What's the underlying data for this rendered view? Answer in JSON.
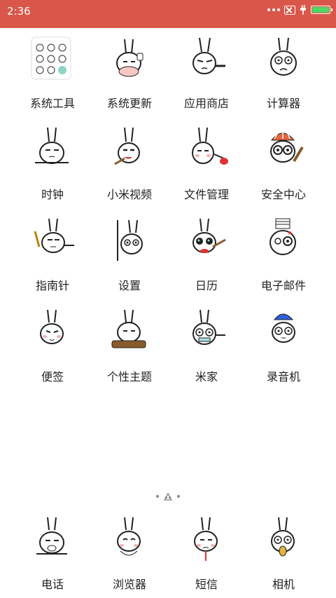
{
  "status": {
    "time": "2:36",
    "icons": [
      "more-dots-icon",
      "no-sim-icon",
      "charging-icon",
      "battery-icon"
    ]
  },
  "apps": [
    {
      "label": "系统工具",
      "icon": "folder-icon"
    },
    {
      "label": "系统更新",
      "icon": "update-icon"
    },
    {
      "label": "应用商店",
      "icon": "store-icon"
    },
    {
      "label": "计算器",
      "icon": "calculator-icon"
    },
    {
      "label": "时钟",
      "icon": "clock-icon"
    },
    {
      "label": "小米视频",
      "icon": "video-icon"
    },
    {
      "label": "文件管理",
      "icon": "file-manager-icon"
    },
    {
      "label": "安全中心",
      "icon": "security-icon"
    },
    {
      "label": "指南针",
      "icon": "compass-icon"
    },
    {
      "label": "设置",
      "icon": "settings-icon"
    },
    {
      "label": "日历",
      "icon": "calendar-icon"
    },
    {
      "label": "电子邮件",
      "icon": "email-icon"
    },
    {
      "label": "便签",
      "icon": "notes-icon"
    },
    {
      "label": "个性主题",
      "icon": "themes-icon"
    },
    {
      "label": "米家",
      "icon": "mijia-icon"
    },
    {
      "label": "录音机",
      "icon": "recorder-icon"
    }
  ],
  "dock": [
    {
      "label": "电话",
      "icon": "phone-icon"
    },
    {
      "label": "浏览器",
      "icon": "browser-icon"
    },
    {
      "label": "短信",
      "icon": "messages-icon"
    },
    {
      "label": "相机",
      "icon": "camera-icon"
    }
  ]
}
